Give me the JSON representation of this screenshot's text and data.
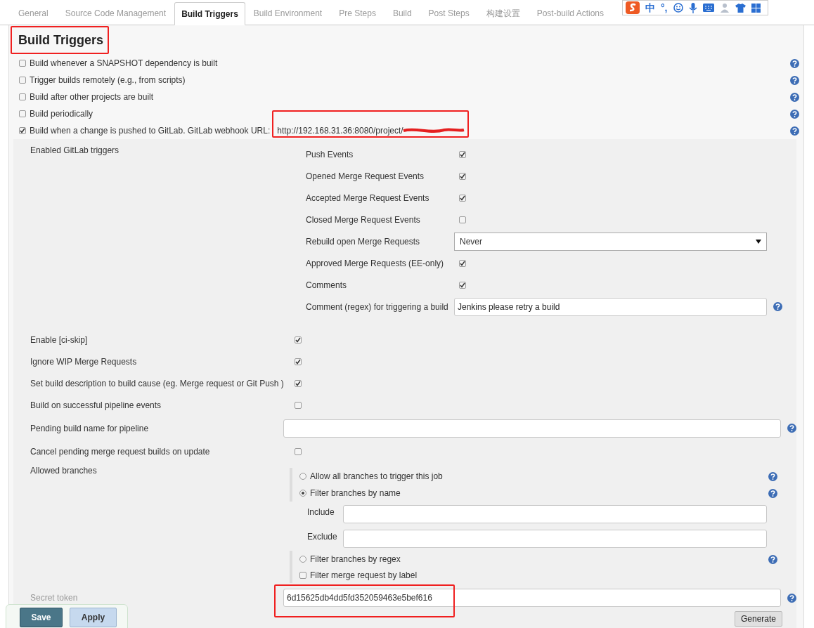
{
  "tabs": [
    {
      "label": "General",
      "selected": false
    },
    {
      "label": "Source Code Management",
      "selected": false
    },
    {
      "label": "Build Triggers",
      "selected": true
    },
    {
      "label": "Build Environment",
      "selected": false
    },
    {
      "label": "Pre Steps",
      "selected": false
    },
    {
      "label": "Build",
      "selected": false
    },
    {
      "label": "Post Steps",
      "selected": false
    },
    {
      "label": "构建设置",
      "selected": false
    },
    {
      "label": "Post-build Actions",
      "selected": false
    }
  ],
  "ime_toolbar": {
    "texts": [
      "中",
      "°,"
    ]
  },
  "heading": "Build Triggers",
  "triggers": [
    {
      "label": "Build whenever a SNAPSHOT dependency is built",
      "checked": false
    },
    {
      "label": "Trigger builds remotely (e.g., from scripts)",
      "checked": false
    },
    {
      "label": "Build after other projects are built",
      "checked": false
    },
    {
      "label": "Build periodically",
      "checked": false
    },
    {
      "label": "Build when a change is pushed to GitLab. GitLab webhook URL:",
      "checked": true,
      "webhook_url": "http://192.168.31.36:8080/project/"
    }
  ],
  "gitlab": {
    "label": "Enabled GitLab triggers",
    "events": [
      {
        "kind": "checkbox",
        "label": "Push Events",
        "checked": true
      },
      {
        "kind": "checkbox",
        "label": "Opened Merge Request Events",
        "checked": true
      },
      {
        "kind": "checkbox",
        "label": "Accepted Merge Request Events",
        "checked": true
      },
      {
        "kind": "checkbox",
        "label": "Closed Merge Request Events",
        "checked": false
      },
      {
        "kind": "select",
        "label": "Rebuild open Merge Requests",
        "value": "Never"
      },
      {
        "kind": "checkbox",
        "label": "Approved Merge Requests (EE-only)",
        "checked": true
      },
      {
        "kind": "checkbox",
        "label": "Comments",
        "checked": true
      },
      {
        "kind": "text",
        "label": "Comment (regex) for triggering a build",
        "value": "Jenkins please retry a build"
      }
    ]
  },
  "options": [
    {
      "kind": "checkbox",
      "label": "Enable [ci-skip]",
      "checked": true
    },
    {
      "kind": "checkbox",
      "label": "Ignore WIP Merge Requests",
      "checked": true
    },
    {
      "kind": "checkbox",
      "label": "Set build description to build cause (eg. Merge request or Git Push )",
      "checked": true
    },
    {
      "kind": "checkbox",
      "label": "Build on successful pipeline events",
      "checked": false
    },
    {
      "kind": "text",
      "label": "Pending build name for pipeline"
    },
    {
      "kind": "checkbox",
      "label": "Cancel pending merge request builds on update",
      "checked": false
    }
  ],
  "allowed_branches": {
    "label": "Allowed branches",
    "choices": [
      {
        "kind": "radio",
        "label": "Allow all branches to trigger this job",
        "selected": false
      },
      {
        "kind": "radio",
        "label": "Filter branches by name",
        "selected": true,
        "fields": [
          {
            "label": "Include"
          },
          {
            "label": "Exclude"
          }
        ]
      },
      {
        "kind": "radio",
        "label": "Filter branches by regex",
        "selected": false
      },
      {
        "kind": "checkbox",
        "label": "Filter merge request by label",
        "checked": false
      }
    ]
  },
  "secret_token": {
    "label": "Secret token",
    "value": "6d15625db4dd5fd352059463e5bef616",
    "button": "Generate"
  },
  "buttons": [
    "Save",
    "Apply"
  ]
}
